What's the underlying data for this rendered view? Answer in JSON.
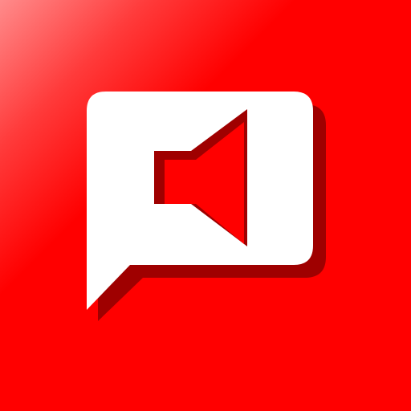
{
  "icon": {
    "name": "speech-bubble-speaker-app-icon",
    "symbol": "speaker-icon",
    "container": "speech-bubble-icon"
  },
  "colors": {
    "background": "#ff0000",
    "background_highlight": "#ff8b8b",
    "bubble": "#ffffff",
    "shadow": "#9f0000",
    "speaker": "#ff0000"
  }
}
